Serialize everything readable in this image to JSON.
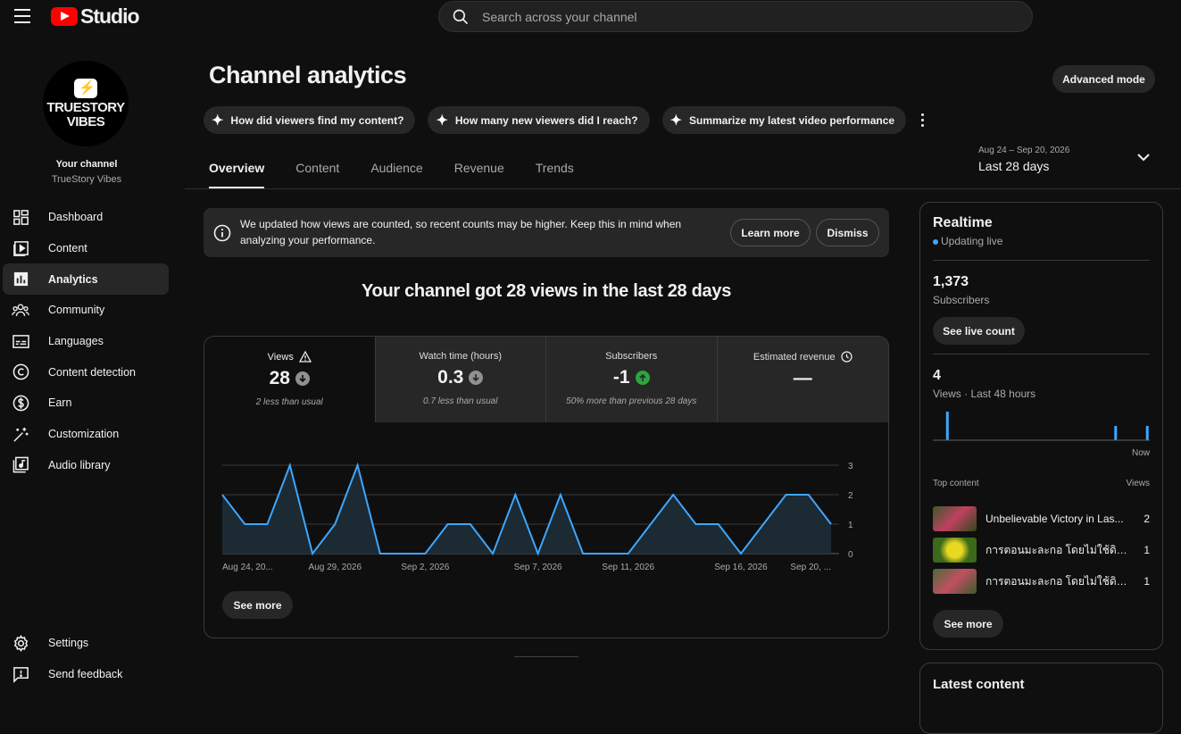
{
  "app": {
    "logo_text": "Studio"
  },
  "search": {
    "placeholder": "Search across your channel"
  },
  "channel": {
    "avatar_line1": "TRUESTORY",
    "avatar_line2": "VIBES",
    "label": "Your channel",
    "name": "TrueStory Vibes"
  },
  "sidebar": {
    "items": [
      {
        "label": "Dashboard",
        "icon": "dashboard-icon"
      },
      {
        "label": "Content",
        "icon": "content-icon"
      },
      {
        "label": "Analytics",
        "icon": "analytics-icon",
        "active": true
      },
      {
        "label": "Community",
        "icon": "community-icon"
      },
      {
        "label": "Languages",
        "icon": "subtitles-icon"
      },
      {
        "label": "Content detection",
        "icon": "copyright-icon"
      },
      {
        "label": "Earn",
        "icon": "dollar-icon"
      },
      {
        "label": "Customization",
        "icon": "magic-wand-icon"
      },
      {
        "label": "Audio library",
        "icon": "audio-library-icon"
      }
    ],
    "bottom": [
      {
        "label": "Settings",
        "icon": "gear-icon"
      },
      {
        "label": "Send feedback",
        "icon": "feedback-icon"
      }
    ]
  },
  "header": {
    "title": "Channel analytics",
    "advanced_mode": "Advanced mode",
    "chips": [
      "How did viewers find my content?",
      "How many new viewers did I reach?",
      "Summarize my latest video performance"
    ]
  },
  "tabs": [
    "Overview",
    "Content",
    "Audience",
    "Revenue",
    "Trends"
  ],
  "date_range": {
    "range": "Aug 24 – Sep 20, 2026",
    "label": "Last 28 days"
  },
  "notice": {
    "text": "We updated how views are counted, so recent counts may be higher. Keep this in mind when analyzing your performance.",
    "learn_more": "Learn more",
    "dismiss": "Dismiss"
  },
  "headline": "Your channel got 28 views in the last 28 days",
  "metrics": [
    {
      "label": "Views",
      "value": "28",
      "sub": "2 less than usual",
      "trend": "down"
    },
    {
      "label": "Watch time (hours)",
      "value": "0.3",
      "sub": "0.7 less than usual",
      "trend": "down"
    },
    {
      "label": "Subscribers",
      "value": "-1",
      "sub": "50% more than previous 28 days",
      "trend": "up"
    },
    {
      "label": "Estimated revenue",
      "value": "—",
      "sub": "",
      "trend": "none"
    }
  ],
  "chart_data": {
    "type": "area",
    "x": [
      "Aug 24",
      "Aug 25",
      "Aug 26",
      "Aug 27",
      "Aug 28",
      "Aug 29",
      "Aug 30",
      "Aug 31",
      "Sep 1",
      "Sep 2",
      "Sep 3",
      "Sep 4",
      "Sep 5",
      "Sep 6",
      "Sep 7",
      "Sep 8",
      "Sep 9",
      "Sep 10",
      "Sep 11",
      "Sep 12",
      "Sep 13",
      "Sep 14",
      "Sep 15",
      "Sep 16",
      "Sep 17",
      "Sep 18",
      "Sep 19",
      "Sep 20"
    ],
    "values": [
      2,
      1,
      1,
      3,
      0,
      1,
      3,
      0,
      0,
      0,
      1,
      1,
      0,
      2,
      0,
      2,
      0,
      0,
      0,
      1,
      2,
      1,
      1,
      0,
      1,
      2,
      2,
      1
    ],
    "tick_labels": [
      "Aug 24, 20...",
      "Aug 29, 2026",
      "Sep 2, 2026",
      "Sep 7, 2026",
      "Sep 11, 2026",
      "Sep 16, 2026",
      "Sep 20, ..."
    ],
    "tick_index": [
      0,
      5,
      9,
      14,
      18,
      23,
      27
    ],
    "yticks": [
      0,
      1,
      2,
      3
    ],
    "ylim": [
      0,
      3
    ],
    "line_color": "#3ea6ff",
    "fill_color": "#1b2a33"
  },
  "see_more": "See more",
  "realtime": {
    "title": "Realtime",
    "status": "Updating live",
    "subscribers": "1,373",
    "subscribers_label": "Subscribers",
    "see_live_count": "See live count",
    "views": "4",
    "views_label": "Views · Last 48 hours",
    "bars": [
      2,
      0,
      0,
      0,
      0,
      0,
      0,
      0,
      0,
      0,
      0,
      0,
      0,
      0,
      0,
      0,
      0,
      0,
      0,
      0,
      0,
      0,
      0,
      0,
      0,
      0,
      0,
      0,
      0,
      0,
      0,
      0,
      0,
      0,
      0,
      0,
      0,
      0,
      0,
      0,
      1,
      0,
      0,
      0,
      0,
      0,
      0,
      1
    ],
    "now_label": "Now",
    "top_content_label": "Top content",
    "views_col_label": "Views",
    "top_content": [
      {
        "title": "Unbelievable Victory in Las...",
        "views": "2",
        "thumb": "#8a4a5a"
      },
      {
        "title": "การตอนมะละกอ โดยไม่ใช้ดิน...",
        "views": "1",
        "thumb": "#9a8a1a"
      },
      {
        "title": "การตอนมะละกอ โดยไม่ใช้ดิน...",
        "views": "1",
        "thumb": "#7a4a4a"
      }
    ],
    "see_more": "See more"
  },
  "latest": {
    "title": "Latest content"
  }
}
